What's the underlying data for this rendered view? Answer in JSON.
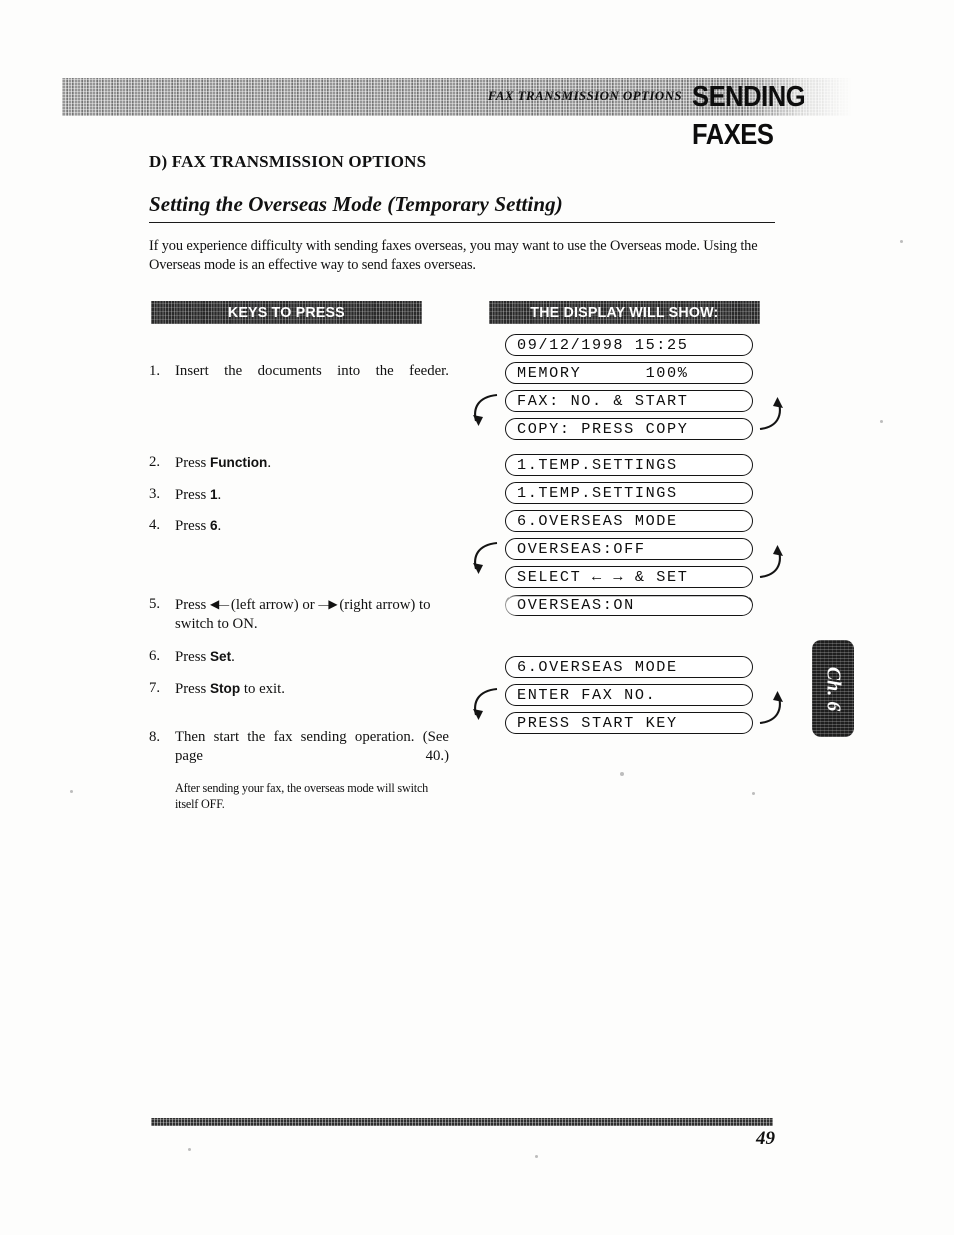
{
  "running_head": {
    "left": "FAX TRANSMISSION OPTIONS",
    "right": "SENDING FAXES"
  },
  "section": {
    "letter_heading": "D) FAX TRANSMISSION OPTIONS",
    "title": "Setting the Overseas Mode (Temporary Setting)",
    "intro": "If you experience difficulty with sending faxes overseas, you may want to use the Overseas mode. Using the Overseas mode is an effective way to send faxes overseas."
  },
  "columns": {
    "keys_header": "KEYS TO PRESS",
    "display_header": "THE DISPLAY WILL SHOW:"
  },
  "steps": [
    {
      "num": "1.",
      "text_before": "Insert the documents into the feeder.",
      "bold": "",
      "text_after": ""
    },
    {
      "num": "2.",
      "text_before": "Press ",
      "bold": "Function",
      "text_after": "."
    },
    {
      "num": "3.",
      "text_before": "Press ",
      "bold": "1",
      "text_after": "."
    },
    {
      "num": "4.",
      "text_before": "Press ",
      "bold": "6",
      "text_after": "."
    },
    {
      "num": "5.",
      "text_before": "Press ",
      "bold": "",
      "text_after": " (left arrow) or  (right arrow) to switch to ON."
    },
    {
      "num": "6.",
      "text_before": "Press ",
      "bold": "Set",
      "text_after": "."
    },
    {
      "num": "7.",
      "text_before": "Press ",
      "bold": "Stop",
      "text_after": " to exit."
    },
    {
      "num": "8.",
      "text_before": "Then start the fax sending operation. (See page 40.)",
      "bold": "",
      "text_after": ""
    }
  ],
  "step5": {
    "lead": "Press",
    "left_arrow_glyph": "◀—",
    "left_arrow_label": "(left arrow) or",
    "right_arrow_glyph": "—▶",
    "right_arrow_label": "(right arrow) to switch to ON."
  },
  "note": "After sending your fax, the overseas mode will switch itself OFF.",
  "display_groups": [
    {
      "id": "group-idle",
      "type": "stack",
      "lines": [
        "09/12/1998 15:25",
        "MEMORY      100%"
      ]
    },
    {
      "id": "group-standby-cycle",
      "type": "alternating_pair",
      "lines": [
        "FAX: NO. & START",
        "COPY: PRESS COPY"
      ]
    },
    {
      "id": "group-temp-settings",
      "type": "stack",
      "lines": [
        "1.TEMP.SETTINGS"
      ]
    },
    {
      "id": "group-temp-settings-2",
      "type": "stack",
      "lines": [
        "1.TEMP.SETTINGS",
        "6.OVERSEAS MODE"
      ]
    },
    {
      "id": "group-overseas-cycle",
      "type": "alternating_pair",
      "lines": [
        "OVERSEAS:OFF",
        "SELECT ← → & SET"
      ]
    },
    {
      "id": "group-overseas-on",
      "type": "stack",
      "lines": [
        "OVERSEAS:ON"
      ]
    },
    {
      "id": "group-overseas-mode-2",
      "type": "stack",
      "lines": [
        "6.OVERSEAS MODE"
      ]
    },
    {
      "id": "group-enter-fax-cycle",
      "type": "alternating_pair",
      "lines": [
        "ENTER FAX NO.",
        "PRESS START KEY"
      ]
    }
  ],
  "chapter_tab": "Ch. 6",
  "page_number": "49"
}
